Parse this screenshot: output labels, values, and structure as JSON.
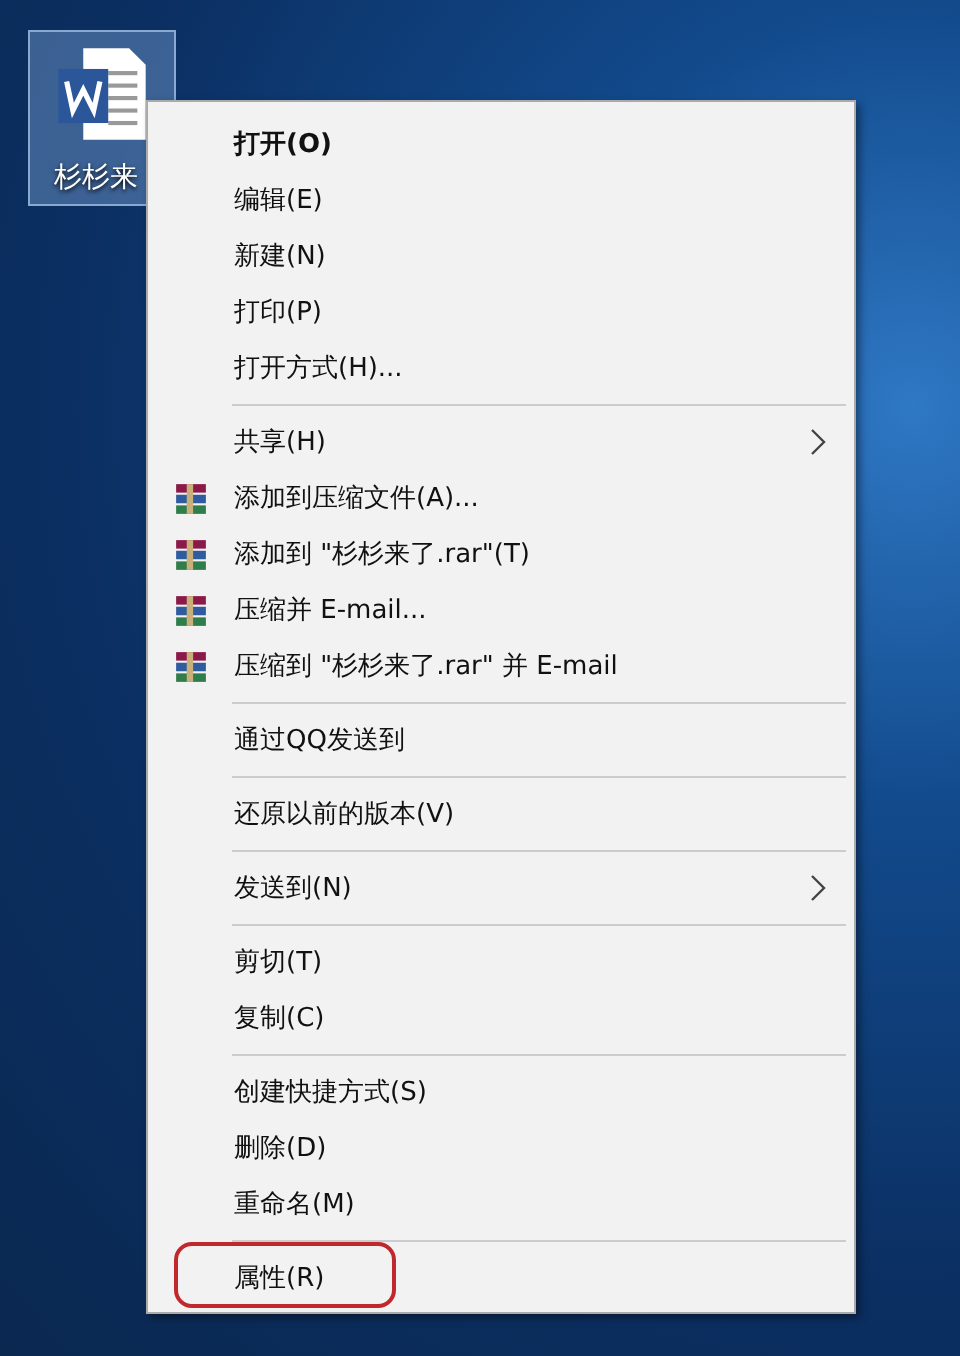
{
  "desktop_icon": {
    "label": "杉杉来",
    "selected": true
  },
  "context_menu": {
    "groups": [
      {
        "items": [
          {
            "label": "打开(O)",
            "kind": "plain",
            "bold": true,
            "submenu": false,
            "annotated": false
          },
          {
            "label": "编辑(E)",
            "kind": "plain",
            "bold": false,
            "submenu": false,
            "annotated": false
          },
          {
            "label": "新建(N)",
            "kind": "plain",
            "bold": false,
            "submenu": false,
            "annotated": false
          },
          {
            "label": "打印(P)",
            "kind": "plain",
            "bold": false,
            "submenu": false,
            "annotated": false
          },
          {
            "label": "打开方式(H)...",
            "kind": "plain",
            "bold": false,
            "submenu": false,
            "annotated": false
          }
        ]
      },
      {
        "items": [
          {
            "label": "共享(H)",
            "kind": "plain",
            "bold": false,
            "submenu": true,
            "annotated": false
          },
          {
            "label": "添加到压缩文件(A)...",
            "kind": "archive",
            "bold": false,
            "submenu": false,
            "annotated": false
          },
          {
            "label": "添加到 \"杉杉来了.rar\"(T)",
            "kind": "archive",
            "bold": false,
            "submenu": false,
            "annotated": false
          },
          {
            "label": "压缩并 E-mail...",
            "kind": "archive",
            "bold": false,
            "submenu": false,
            "annotated": false
          },
          {
            "label": "压缩到 \"杉杉来了.rar\" 并 E-mail",
            "kind": "archive",
            "bold": false,
            "submenu": false,
            "annotated": false
          }
        ]
      },
      {
        "items": [
          {
            "label": "通过QQ发送到",
            "kind": "plain",
            "bold": false,
            "submenu": false,
            "annotated": false
          }
        ]
      },
      {
        "items": [
          {
            "label": "还原以前的版本(V)",
            "kind": "plain",
            "bold": false,
            "submenu": false,
            "annotated": false
          }
        ]
      },
      {
        "items": [
          {
            "label": "发送到(N)",
            "kind": "plain",
            "bold": false,
            "submenu": true,
            "annotated": false
          }
        ]
      },
      {
        "items": [
          {
            "label": "剪切(T)",
            "kind": "plain",
            "bold": false,
            "submenu": false,
            "annotated": false
          },
          {
            "label": "复制(C)",
            "kind": "plain",
            "bold": false,
            "submenu": false,
            "annotated": false
          }
        ]
      },
      {
        "items": [
          {
            "label": "创建快捷方式(S)",
            "kind": "plain",
            "bold": false,
            "submenu": false,
            "annotated": false
          },
          {
            "label": "删除(D)",
            "kind": "plain",
            "bold": false,
            "submenu": false,
            "annotated": false
          },
          {
            "label": "重命名(M)",
            "kind": "plain",
            "bold": false,
            "submenu": false,
            "annotated": false
          }
        ]
      },
      {
        "items": [
          {
            "label": "属性(R)",
            "kind": "plain",
            "bold": false,
            "submenu": false,
            "annotated": true
          }
        ]
      }
    ]
  }
}
